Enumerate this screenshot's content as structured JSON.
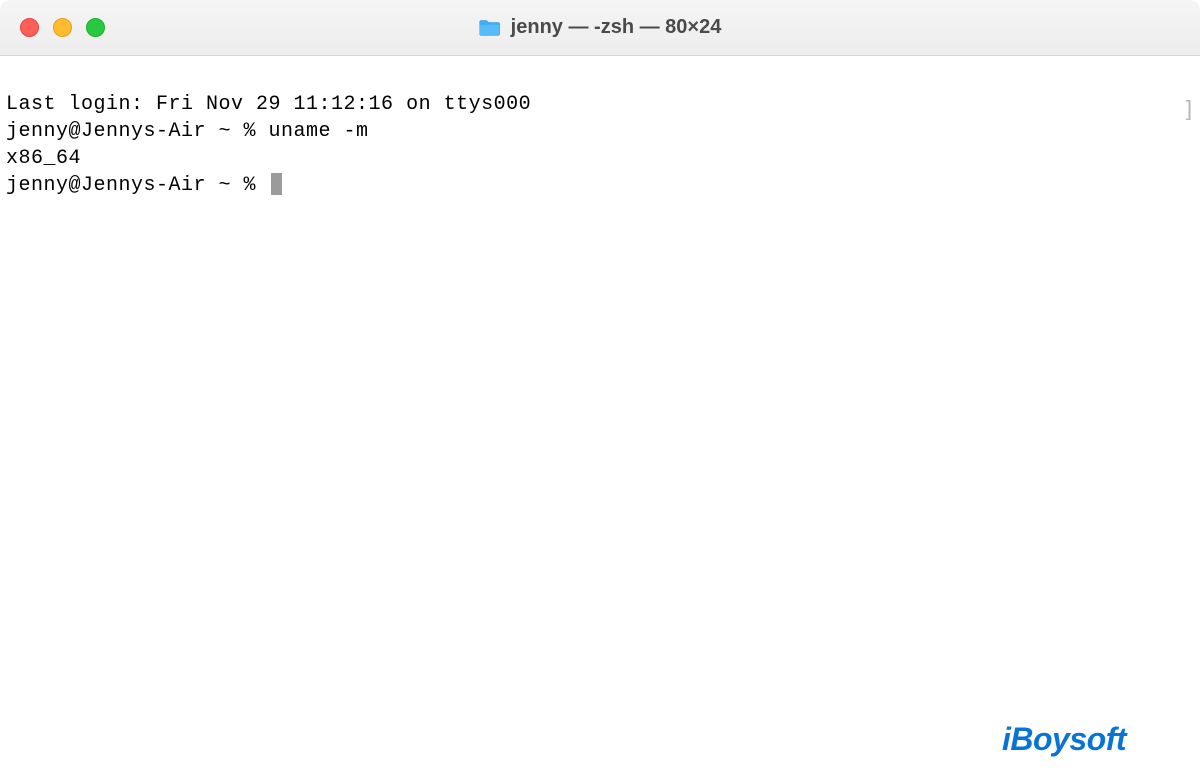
{
  "window": {
    "title": "jenny — -zsh — 80×24",
    "traffic": {
      "close": "close",
      "minimize": "minimize",
      "zoom": "zoom"
    }
  },
  "terminal": {
    "lines": {
      "last_login": "Last login: Fri Nov 29 11:12:16 on ttys000",
      "prompt1": "jenny@Jennys-Air ~ % uname -m",
      "output1": "x86_64",
      "prompt2": "jenny@Jennys-Air ~ % "
    }
  },
  "watermark": {
    "text": "iBoysoft"
  }
}
